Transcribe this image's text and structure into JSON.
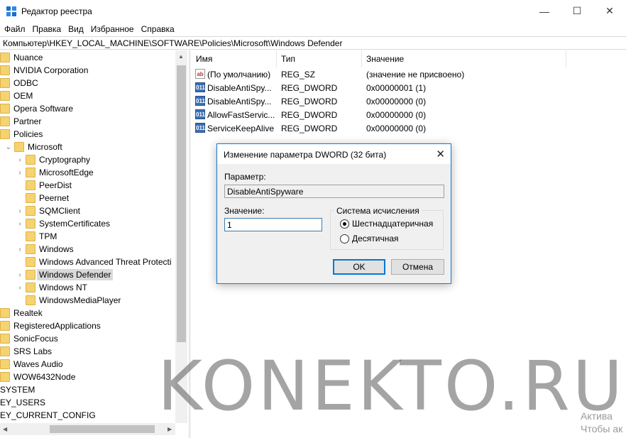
{
  "window": {
    "title": "Редактор реестра",
    "controls": {
      "minimize": "—",
      "maximize": "☐",
      "close": "✕"
    }
  },
  "menu": [
    "Файл",
    "Правка",
    "Вид",
    "Избранное",
    "Справка"
  ],
  "address": "Компьютер\\HKEY_LOCAL_MACHINE\\SOFTWARE\\Policies\\Microsoft\\Windows Defender",
  "tree": {
    "items": [
      {
        "label": "Nuance",
        "level": 0
      },
      {
        "label": "NVIDIA Corporation",
        "level": 0
      },
      {
        "label": "ODBC",
        "level": 0
      },
      {
        "label": "OEM",
        "level": 0
      },
      {
        "label": "Opera Software",
        "level": 0
      },
      {
        "label": "Partner",
        "level": 0
      },
      {
        "label": "Policies",
        "level": 0
      },
      {
        "label": "Microsoft",
        "level": 1,
        "chevron": "expanded"
      },
      {
        "label": "Cryptography",
        "level": 2,
        "chevron": "collapsed"
      },
      {
        "label": "MicrosoftEdge",
        "level": 2,
        "chevron": "collapsed"
      },
      {
        "label": "PeerDist",
        "level": 2
      },
      {
        "label": "Peernet",
        "level": 2
      },
      {
        "label": "SQMClient",
        "level": 2,
        "chevron": "collapsed"
      },
      {
        "label": "SystemCertificates",
        "level": 2,
        "chevron": "collapsed"
      },
      {
        "label": "TPM",
        "level": 2
      },
      {
        "label": "Windows",
        "level": 2,
        "chevron": "collapsed"
      },
      {
        "label": "Windows Advanced Threat Protecti",
        "level": 2
      },
      {
        "label": "Windows Defender",
        "level": 2,
        "chevron": "collapsed",
        "selected": true
      },
      {
        "label": "Windows NT",
        "level": 2,
        "chevron": "collapsed"
      },
      {
        "label": "WindowsMediaPlayer",
        "level": 2
      },
      {
        "label": "Realtek",
        "level": 0
      },
      {
        "label": "RegisteredApplications",
        "level": 0
      },
      {
        "label": "SonicFocus",
        "level": 0
      },
      {
        "label": "SRS Labs",
        "level": 0
      },
      {
        "label": "Waves Audio",
        "level": 0
      },
      {
        "label": "WOW6432Node",
        "level": 0
      },
      {
        "label": "SYSTEM",
        "level": -1
      },
      {
        "label": "EY_USERS",
        "level": -1
      },
      {
        "label": "EY_CURRENT_CONFIG",
        "level": -1
      }
    ]
  },
  "list": {
    "columns": [
      "Имя",
      "Тип",
      "Значение"
    ],
    "rows": [
      {
        "icon": "string-value-icon",
        "badge": "ab",
        "name": "(По умолчанию)",
        "type": "REG_SZ",
        "value": "(значение не присвоено)"
      },
      {
        "icon": "dword-value-icon",
        "badge": "011",
        "name": "DisableAntiSpy...",
        "type": "REG_DWORD",
        "value": "0x00000001 (1)"
      },
      {
        "icon": "dword-value-icon",
        "badge": "011",
        "name": "DisableAntiSpy...",
        "type": "REG_DWORD",
        "value": "0x00000000 (0)"
      },
      {
        "icon": "dword-value-icon",
        "badge": "011",
        "name": "AllowFastServic...",
        "type": "REG_DWORD",
        "value": "0x00000000 (0)"
      },
      {
        "icon": "dword-value-icon",
        "badge": "011",
        "name": "ServiceKeepAlive",
        "type": "REG_DWORD",
        "value": "0x00000000 (0)"
      }
    ]
  },
  "dialog": {
    "title": "Изменение параметра DWORD (32 бита)",
    "param_label": "Параметр:",
    "param_value": "DisableAntiSpyware",
    "value_label": "Значение:",
    "value_input": "1",
    "base_group_title": "Система исчисления",
    "radio_hex": "Шестнадцатеричная",
    "radio_dec": "Десятичная",
    "selected_base": "hex",
    "ok": "OK",
    "cancel": "Отмена"
  },
  "watermark": "KONEKTO.RU",
  "activation": {
    "line1": "Актива",
    "line2": "Чтобы ак"
  },
  "colors": {
    "folder": "#f6d36e",
    "dialog_border": "#1979ca",
    "default_button_border": "#0078d7",
    "selected_tree_bg": "#d9d9d9"
  }
}
